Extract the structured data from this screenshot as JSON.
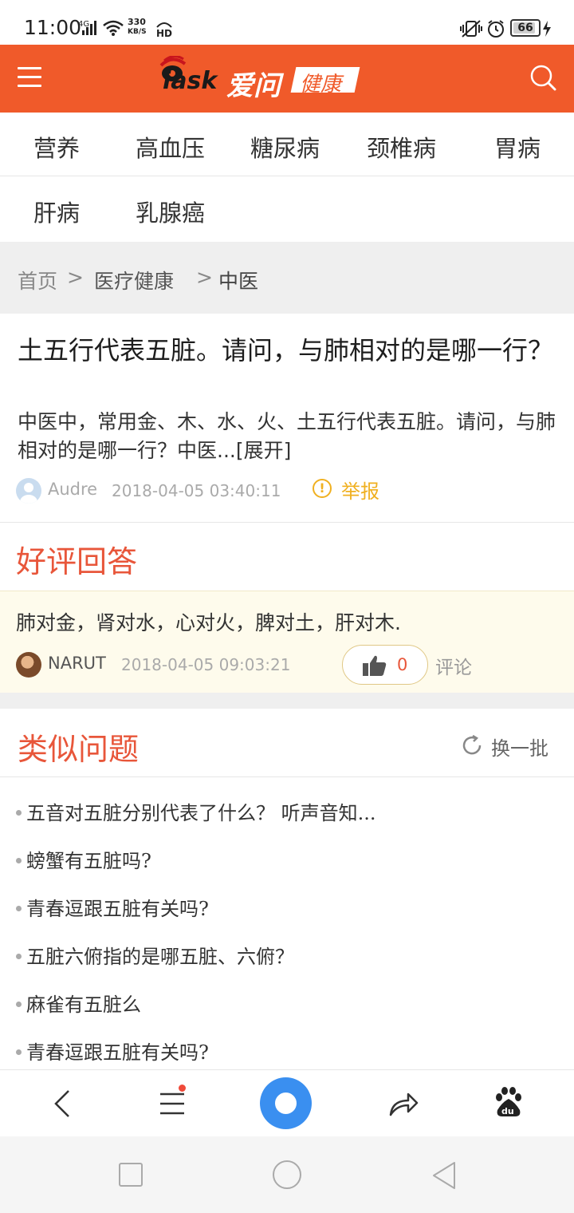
{
  "status_bar": {
    "time": "11:00",
    "network": "4G",
    "speed_value": "330",
    "speed_unit": "KB/S",
    "hd": "HD",
    "battery": "66"
  },
  "header": {
    "logo_brand": "iask",
    "logo_aiwen": "爱问",
    "logo_section": "健康",
    "accent_color": "#f05a2a"
  },
  "categories": [
    "营养",
    "高血压",
    "糖尿病",
    "颈椎病",
    "胃病",
    "肝病",
    "乳腺癌"
  ],
  "breadcrumb": {
    "home": "首页",
    "sep1": ">",
    "level1": "医疗健康",
    "sep2": ">",
    "level2": "中医"
  },
  "question": {
    "title": "土五行代表五脏。请问，与肺相对的是哪一行？",
    "body": "中医中，常用金、木、水、火、土五行代表五脏。请问，与肺相对的是哪一行？中医...",
    "expand": "[展开]",
    "user": "Audre",
    "time": "2018-04-05 03:40:11",
    "report_icon": "!",
    "report": "举报"
  },
  "good_answer": {
    "section_title": "好评回答",
    "text": "肺对金，肾对水，心对火，脾对土，肝对木.",
    "user": "NARUT",
    "time": "2018-04-05 09:03:21",
    "likes": "0",
    "comment": "评论"
  },
  "similar": {
    "section_title": "类似问题",
    "refresh": "换一批",
    "items": [
      "五音对五脏分别代表了什么？ 听声音知...",
      "螃蟹有五脏吗?",
      "青春逗跟五脏有关吗?",
      "五脏六俯指的是哪五脏、六俯？",
      "麻雀有五脏么",
      "青春逗跟五脏有关吗?"
    ]
  },
  "bottom_bar": {
    "icons": [
      "back-icon",
      "menu-icon",
      "home-icon",
      "share-icon",
      "baidu-icon"
    ]
  }
}
